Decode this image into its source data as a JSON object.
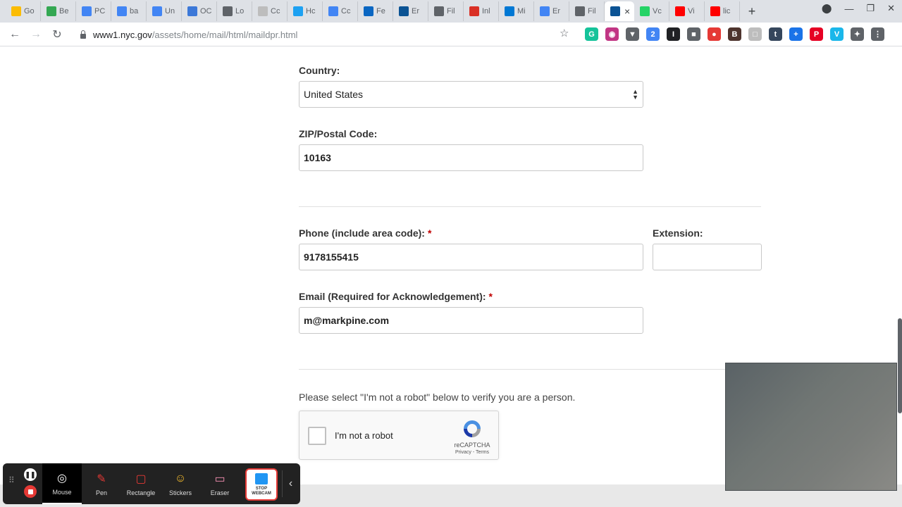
{
  "browser": {
    "tabs": [
      {
        "label": "Go",
        "color": "#fbbc04"
      },
      {
        "label": "Be",
        "color": "#34a853"
      },
      {
        "label": "PC",
        "color": "#4285f4"
      },
      {
        "label": "ba",
        "color": "#4285f4"
      },
      {
        "label": "Un",
        "color": "#4285f4"
      },
      {
        "label": "OC",
        "color": "#3c78d8"
      },
      {
        "label": "Lo",
        "color": "#5f6368"
      },
      {
        "label": "Cc",
        "color": "#bdbdbd"
      },
      {
        "label": "Hc",
        "color": "#1da1f2"
      },
      {
        "label": "Cc",
        "color": "#4285f4"
      },
      {
        "label": "Fe",
        "color": "#0a66c2"
      },
      {
        "label": "Er",
        "color": "#0b5394"
      },
      {
        "label": "Fil",
        "color": "#5f6368"
      },
      {
        "label": "Inl",
        "color": "#d93025"
      },
      {
        "label": "Mi",
        "color": "#0078d4"
      },
      {
        "label": "Er",
        "color": "#4285f4"
      },
      {
        "label": "Fil",
        "color": "#5f6368"
      },
      {
        "label": "",
        "color": "#0b5394",
        "active": true
      },
      {
        "label": "Vc",
        "color": "#25d366"
      },
      {
        "label": "Vi",
        "color": "#ff0000"
      },
      {
        "label": "lic",
        "color": "#ff0000"
      }
    ],
    "url_host": "www1.nyc.gov",
    "url_path": "/assets/home/mail/html/maildpr.html",
    "extensions": [
      {
        "glyph": "G",
        "color": "#15c39a"
      },
      {
        "glyph": "◉",
        "color": "#c13584"
      },
      {
        "glyph": "▼",
        "color": "#5f6368"
      },
      {
        "glyph": "2",
        "color": "#4285f4"
      },
      {
        "glyph": "I",
        "color": "#202124"
      },
      {
        "glyph": "■",
        "color": "#5f6368"
      },
      {
        "glyph": "●",
        "color": "#e53935"
      },
      {
        "glyph": "B",
        "color": "#4e342e"
      },
      {
        "glyph": "□",
        "color": "#bdbdbd"
      },
      {
        "glyph": "t",
        "color": "#35465c"
      },
      {
        "glyph": "+",
        "color": "#1a73e8"
      },
      {
        "glyph": "P",
        "color": "#e60023"
      },
      {
        "glyph": "V",
        "color": "#1ab7ea"
      },
      {
        "glyph": "✦",
        "color": "#5f6368"
      },
      {
        "glyph": "⋮",
        "color": "#5f6368"
      }
    ]
  },
  "form": {
    "country_label": "Country:",
    "country_value": "United States",
    "zip_label": "ZIP/Postal Code:",
    "zip_value": "10163",
    "phone_label": "Phone (include area code):",
    "phone_value": "9178155415",
    "extension_label": "Extension:",
    "extension_value": "",
    "email_label": "Email (Required for Acknowledgement):",
    "email_value": "m@markpine.com",
    "required_marker": "*",
    "robot_note": "Please select \"I'm not a robot\" below to verify you are a person.",
    "captcha_label": "I'm not a robot",
    "captcha_brand": "reCAPTCHA",
    "captcha_links": "Privacy - Terms"
  },
  "recorder": {
    "tools": [
      {
        "label": "Mouse",
        "active": true
      },
      {
        "label": "Pen"
      },
      {
        "label": "Rectangle"
      },
      {
        "label": "Stickers"
      },
      {
        "label": "Eraser"
      }
    ],
    "stop_webcam_label": "STOP WEBCAM"
  }
}
